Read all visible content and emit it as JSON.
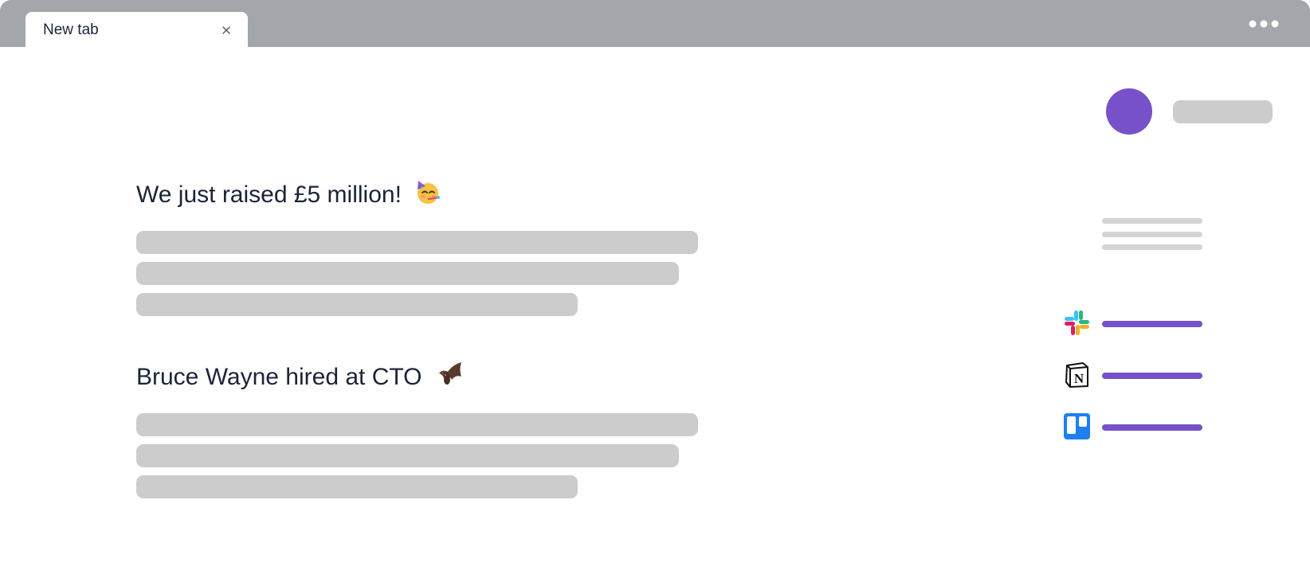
{
  "browser": {
    "tab_title": "New tab",
    "close_icon": "close-icon",
    "menu_icon": "more-dots-icon"
  },
  "user": {
    "avatar_color": "#7651c9"
  },
  "news": [
    {
      "title": "We just raised £5 million!",
      "emoji_icon": "partying-face-icon"
    },
    {
      "title": "Bruce Wayne hired at CTO",
      "emoji_icon": "bat-icon"
    }
  ],
  "apps": [
    {
      "icon": "slack-icon"
    },
    {
      "icon": "notion-icon"
    },
    {
      "icon": "trello-icon"
    }
  ],
  "colors": {
    "accent": "#7651c9",
    "placeholder": "#cccccc",
    "tabbar": "#a3a6aa",
    "text": "#1b2437"
  }
}
